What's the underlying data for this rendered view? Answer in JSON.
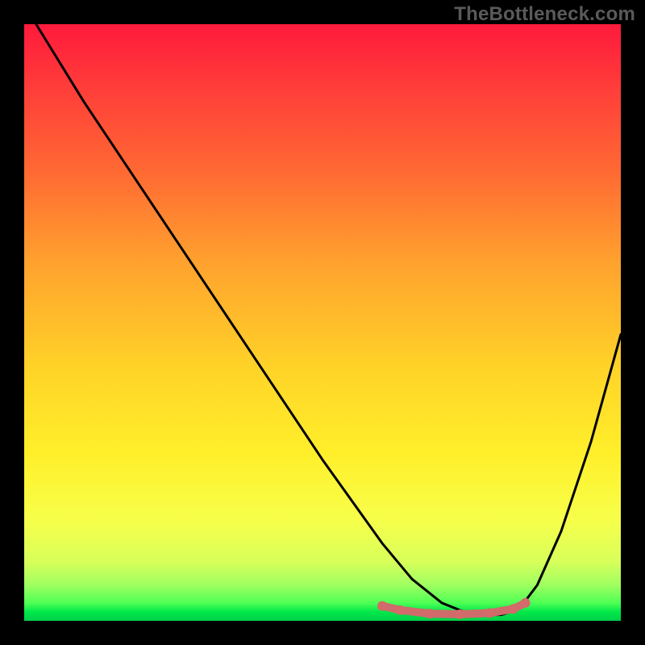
{
  "watermark": "TheBottleneck.com",
  "chart_data": {
    "type": "line",
    "title": "",
    "xlabel": "",
    "ylabel": "",
    "xlim": [
      0,
      100
    ],
    "ylim": [
      0,
      100
    ],
    "grid": false,
    "legend": false,
    "series": [
      {
        "name": "curve",
        "color": "#000000",
        "x": [
          2,
          10,
          20,
          30,
          40,
          50,
          55,
          60,
          65,
          70,
          75,
          80,
          83,
          86,
          90,
          95,
          100
        ],
        "y": [
          100,
          87,
          72,
          57,
          42,
          27,
          20,
          13,
          7,
          3,
          1,
          1,
          2,
          6,
          15,
          30,
          48
        ]
      },
      {
        "name": "highlight",
        "color": "#d46a6a",
        "x": [
          60,
          63,
          68,
          73,
          78,
          82,
          84
        ],
        "y": [
          2.5,
          1.8,
          1.2,
          1.1,
          1.3,
          2.0,
          3.0
        ]
      }
    ],
    "gradient_stops": [
      {
        "pos": 0,
        "color": "#ff1a3c"
      },
      {
        "pos": 25,
        "color": "#ff6a33"
      },
      {
        "pos": 58,
        "color": "#ffd428"
      },
      {
        "pos": 90,
        "color": "#d9ff5a"
      },
      {
        "pos": 100,
        "color": "#00d048"
      }
    ]
  }
}
